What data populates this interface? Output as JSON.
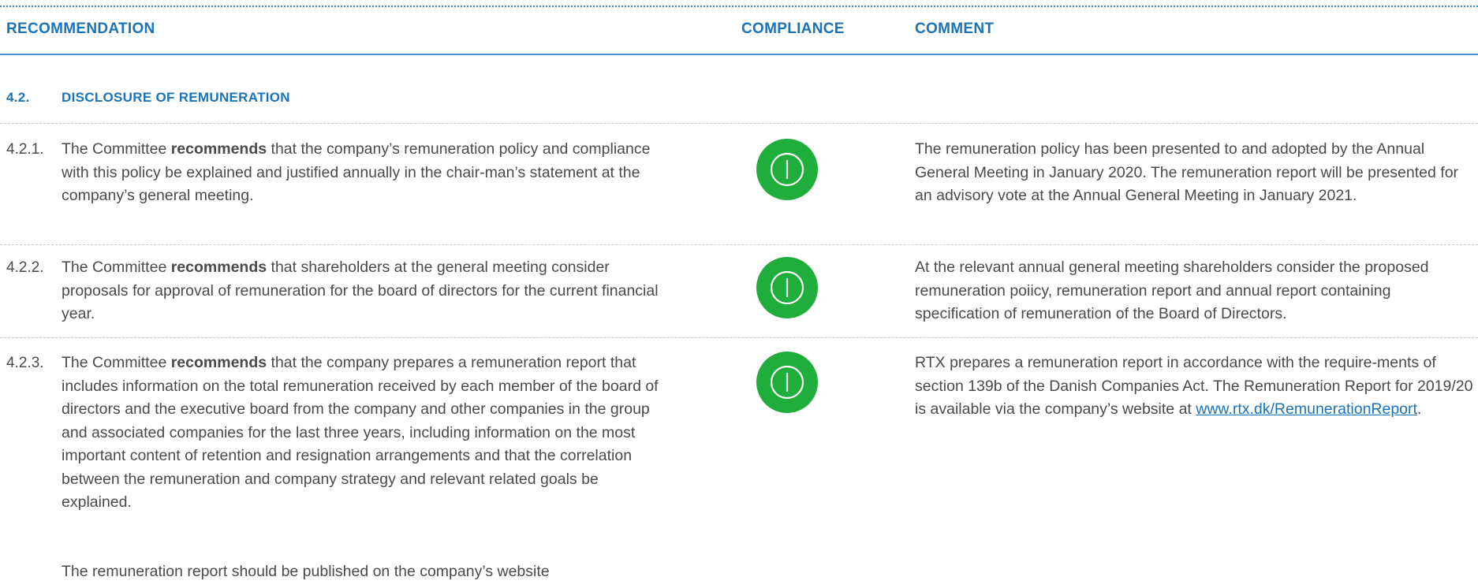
{
  "header": {
    "recommendation": "RECOMMENDATION",
    "compliance": "COMPLIANCE",
    "comment": "COMMENT"
  },
  "section": {
    "number": "4.2.",
    "title": "DISCLOSURE OF REMUNERATION"
  },
  "compliance_color": "#1fad3c",
  "compliance_icon": "power-icon",
  "rows": [
    {
      "number": "4.2.1.",
      "rec_prefix": "The Committee ",
      "rec_bold": "recommends",
      "rec_suffix": " that the company’s remuneration policy and compliance with this policy be explained and justified annually in the chair-man’s statement at the company’s general meeting.",
      "comment": "The remuneration policy has been presented to and adopted by the Annual General Meeting in January 2020. The remuneration report will be presented for an advisory vote at the Annual General Meeting in January 2021."
    },
    {
      "number": "4.2.2.",
      "rec_prefix": "The Committee ",
      "rec_bold": "recommends",
      "rec_suffix": " that shareholders at the general meeting consider proposals for approval of remuneration for the board of directors for the current financial year.",
      "comment": "At the relevant annual general meeting shareholders consider the proposed remuneration poiicy, remuneration report and annual report containing specification of remuneration of the Board of Directors."
    },
    {
      "number": "4.2.3.",
      "rec_prefix": "The Committee ",
      "rec_bold": "recommends",
      "rec_suffix": " that the company prepares a remuneration report that includes information on the total remuneration received by each member of the board of directors and the executive board from the company and other companies in the group and associated companies for the last three years, including information on the most important content of retention and resignation arrangements and that the correlation between the remuneration and company strategy and relevant related goals be explained.",
      "rec_para2": "The remuneration report should be published on the company’s website",
      "comment": "RTX prepares a remuneration report  in accordance with the require-ments of section 139b of the Danish Companies Act. The Remuneration Report for 2019/20 is available via the company’s website at ",
      "comment_link": "www.rtx.dk/RemunerationReport",
      "comment_end": "."
    }
  ]
}
